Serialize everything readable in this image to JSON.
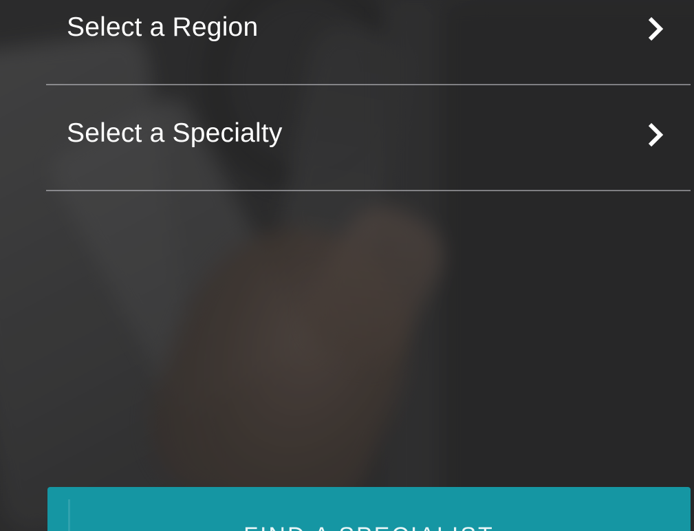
{
  "menu": {
    "items": [
      {
        "label": "Select a Region",
        "icon": "chevron-right-icon"
      },
      {
        "label": "Select a Specialty",
        "icon": "chevron-right-icon"
      }
    ]
  },
  "cta": {
    "label": "FIND A SPECIALIST"
  },
  "colors": {
    "accent": "#1596a3",
    "background": "#353536",
    "text": "#ffffff",
    "divider": "#c8c8cd"
  }
}
